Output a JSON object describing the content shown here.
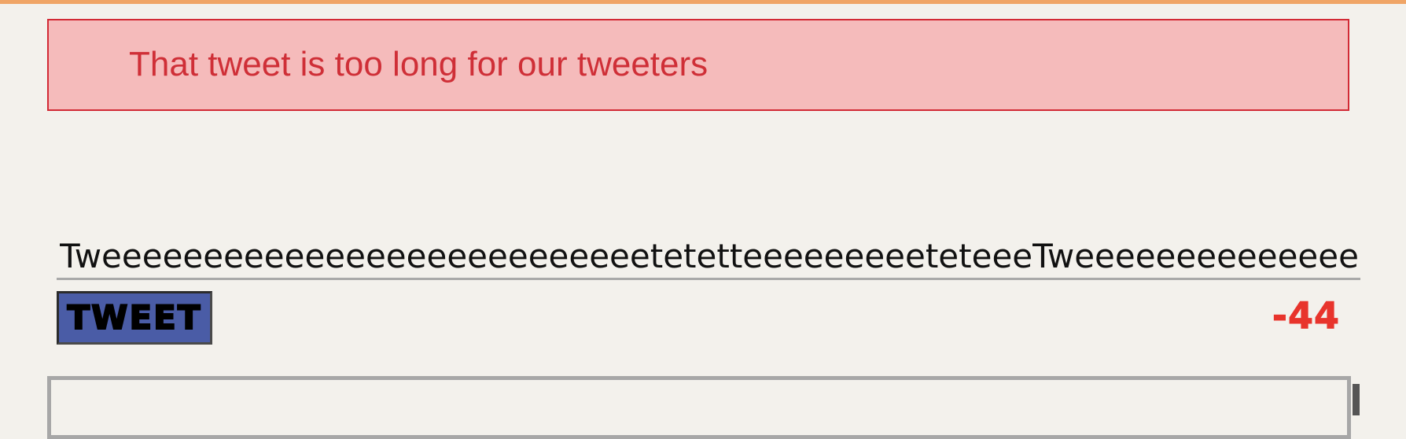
{
  "error": {
    "message": "That tweet is too long for our tweeters"
  },
  "composer": {
    "input_value": "TweeeeeeeeeeeeeeeeeeeeeeeeeeetetetteeeeeeeeeteteeeTweeeeeeeeeeeeeeeeeeeeeeeeeeee",
    "button_label": "TWEET",
    "char_count": "-44"
  },
  "colors": {
    "error_background": "#f5bbbb",
    "error_border": "#d22a35",
    "error_text": "#cf2f37",
    "button_background": "#4a5ca6",
    "counter_negative": "#e8342c",
    "page_background": "#f3f1ec",
    "top_accent": "#f0a566"
  }
}
